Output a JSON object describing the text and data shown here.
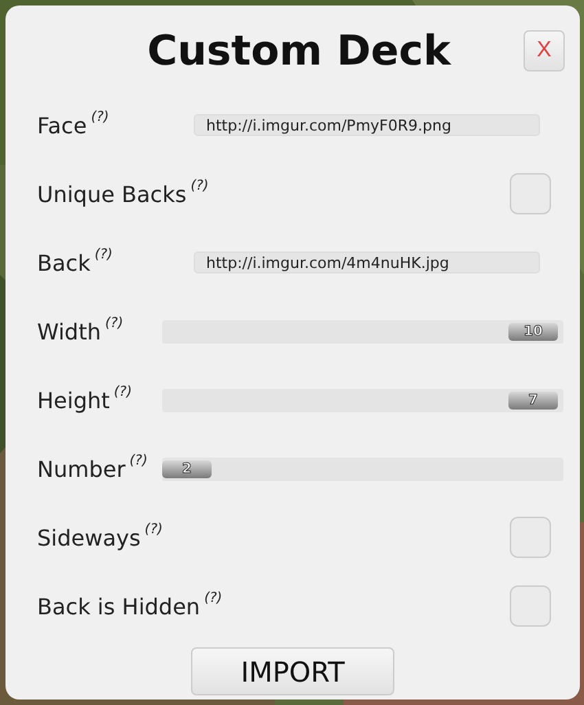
{
  "dialog": {
    "title": "Custom Deck",
    "close": "X"
  },
  "rows": [
    {
      "kind": "text",
      "label": "Face",
      "help": "(?)",
      "value": "http://i.imgur.com/PmyF0R9.png"
    },
    {
      "kind": "checkbox",
      "label": "Unique Backs",
      "help": "(?)",
      "checked": false
    },
    {
      "kind": "text",
      "label": "Back",
      "help": "(?)",
      "value": "http://i.imgur.com/4m4nuHK.jpg"
    },
    {
      "kind": "slider",
      "label": "Width",
      "help": "(?)",
      "level": 1,
      "reading": "10"
    },
    {
      "kind": "slider",
      "label": "Height",
      "help": "(?)",
      "level": 1,
      "reading": "7"
    },
    {
      "kind": "slider",
      "label": "Number",
      "help": "(?)",
      "level": 0,
      "reading": "2"
    },
    {
      "kind": "checkbox",
      "label": "Sideways",
      "help": "(?)",
      "checked": false
    },
    {
      "kind": "checkbox",
      "label": "Back is Hidden",
      "help": "(?)",
      "checked": false
    }
  ],
  "button": "IMPORT"
}
